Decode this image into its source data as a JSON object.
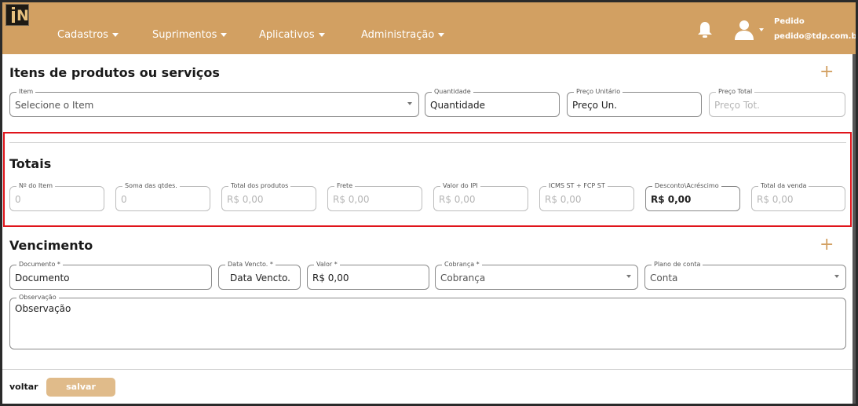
{
  "nav": {
    "menus": [
      "Cadastros",
      "Suprimentos",
      "Aplicativos",
      "Administração"
    ],
    "user_name": "Pedido",
    "user_email": "pedido@tdp.com.br"
  },
  "items_section": {
    "title": "Itens de produtos ou serviços",
    "item": {
      "label": "Item",
      "placeholder": "Selecione o Item"
    },
    "quantidade": {
      "label": "Quantidade",
      "placeholder": "Quantidade"
    },
    "preco_unitario": {
      "label": "Preço Unitário",
      "placeholder": "Preço Un."
    },
    "preco_total": {
      "label": "Preço Total",
      "placeholder": "Preço Tot."
    }
  },
  "totals_section": {
    "title": "Totais",
    "fields": [
      {
        "label": "Nº do Item",
        "value": "0"
      },
      {
        "label": "Soma das qtdes.",
        "value": "0"
      },
      {
        "label": "Total dos produtos",
        "value": "R$ 0,00"
      },
      {
        "label": "Frete",
        "value": "R$ 0,00"
      },
      {
        "label": "Valor do IPI",
        "value": "R$ 0,00"
      },
      {
        "label": "ICMS ST + FCP ST",
        "value": "R$ 0,00"
      },
      {
        "label": "Desconto\\Acréscimo",
        "value": "R$ 0,00"
      },
      {
        "label": "Total da venda",
        "value": "R$ 0,00"
      }
    ]
  },
  "due_section": {
    "title": "Vencimento",
    "documento": {
      "label": "Documento *",
      "placeholder": "Documento"
    },
    "data_vencto": {
      "label": "Data Vencto. *",
      "placeholder": "Data Vencto."
    },
    "valor": {
      "label": "Valor *",
      "value": "R$ 0,00"
    },
    "cobranca": {
      "label": "Cobrança *",
      "placeholder": "Cobrança"
    },
    "plano_conta": {
      "label": "Plano de conta",
      "placeholder": "Conta"
    },
    "observacao": {
      "label": "Observação",
      "placeholder": "Observação"
    }
  },
  "footer": {
    "back_label": "voltar",
    "save_label": "salvar"
  },
  "icons": {
    "add": "plus-icon",
    "bell": "bell-icon",
    "user": "user-icon"
  },
  "colors": {
    "brand": "#d2a062",
    "highlight": "#e0141b",
    "save_button": "#e0bb8a"
  }
}
